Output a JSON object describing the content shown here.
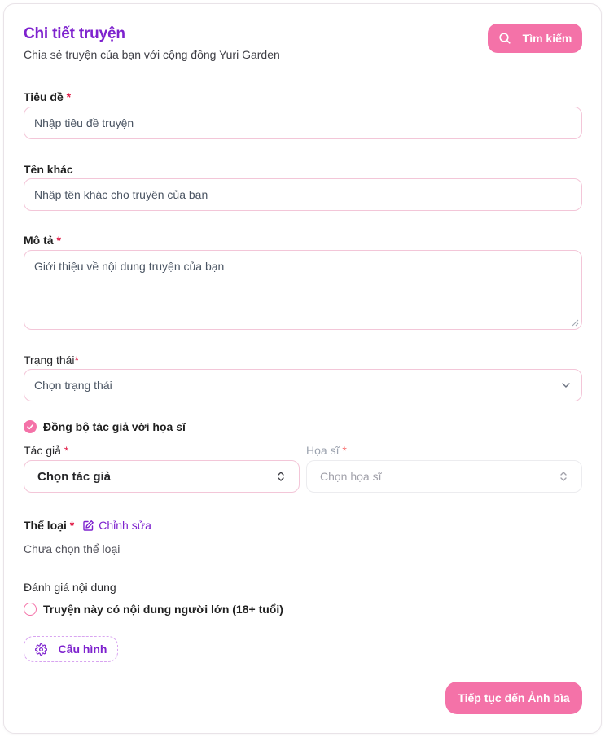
{
  "header": {
    "title": "Chi tiết truyện",
    "subtitle": "Chia sẻ truyện của bạn với cộng đồng Yuri Garden",
    "search_label": "Tìm kiếm"
  },
  "form": {
    "title_field": {
      "label": "Tiêu đề",
      "required": "*",
      "placeholder": "Nhập tiêu đề truyện"
    },
    "alt_name_field": {
      "label": "Tên khác",
      "placeholder": "Nhập tên khác cho truyện của bạn"
    },
    "description_field": {
      "label": "Mô tả",
      "required": "*",
      "placeholder": "Giới thiệu về nội dung truyện của bạn"
    },
    "status_field": {
      "label": "Trạng thái",
      "required": "*",
      "selected": "Chọn trạng thái"
    },
    "sync_checkbox": {
      "label": "Đồng bộ tác giả với họa sĩ",
      "checked": true
    },
    "author_field": {
      "label": "Tác giả",
      "required": "*",
      "selected": "Chọn tác giả"
    },
    "artist_field": {
      "label": "Họa sĩ",
      "required": "*",
      "selected": "Chọn họa sĩ"
    },
    "genre_field": {
      "label": "Thể loại",
      "required": "*",
      "edit_label": "Chỉnh sửa",
      "empty_text": "Chưa chọn thể loại"
    },
    "rating_field": {
      "label": "Đánh giá nội dung",
      "adult_option": "Truyện này có nội dung người lớn (18+ tuổi)",
      "adult_checked": false
    }
  },
  "actions": {
    "config_label": "Cấu hình",
    "next_label": "Tiếp tục đến Ảnh bìa"
  },
  "colors": {
    "accent_purple": "#7e22ce",
    "accent_pink": "#f472a8",
    "border_pink": "#f3c6d8",
    "required_red": "#e11d48"
  }
}
